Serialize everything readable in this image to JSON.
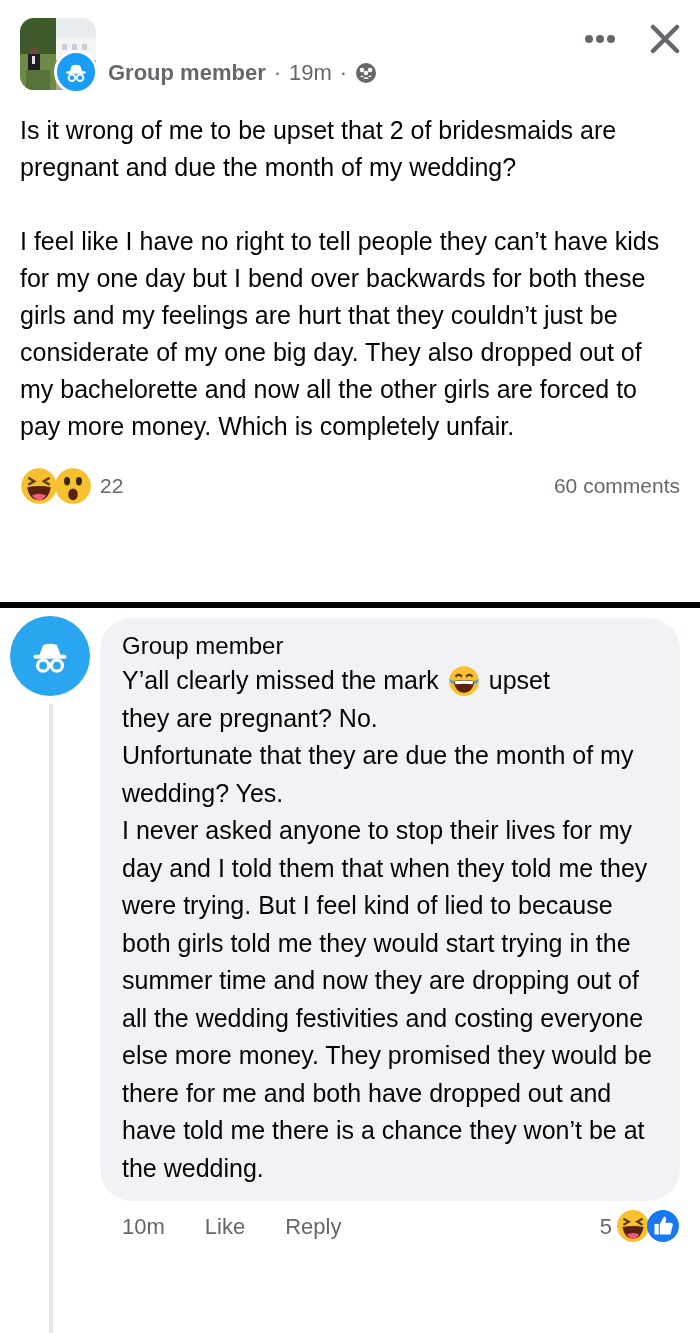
{
  "post": {
    "author": "Group member",
    "time": "19m",
    "separator": "·",
    "paragraphs": [
      "Is it wrong of me to be upset that 2 of bridesmaids are pregnant and due the month of my wedding?",
      "I feel like I have no right to tell people they can’t have kids for my one day but I bend over backwards for both these girls and my feelings are hurt that they couldn’t just be considerate of my one big day. They also dropped out of my bachelorette and now all the other girls are forced to pay more money. Which is completely unfair."
    ],
    "reaction_count": "22",
    "comments_count": "60 comments"
  },
  "comment": {
    "author": "Group member",
    "text_before_emoji": "Y’all clearly missed the mark",
    "text_after_emoji": "upset",
    "lines": [
      "they are pregnant? No.",
      "Unfortunate that they are due the month of my wedding? Yes.",
      "I never asked anyone to stop their lives for my day and I told them that when they told me they were trying. But I feel kind of lied to because both girls told me they would start trying in the summer time and now they are dropping out of all the wedding festivities and costing everyone else more money. They promised they would be there for me and both have dropped out and have told me there is a chance they won’t be at the wedding."
    ],
    "time": "10m",
    "actions": [
      "Like",
      "Reply"
    ],
    "reaction_count": "5"
  }
}
